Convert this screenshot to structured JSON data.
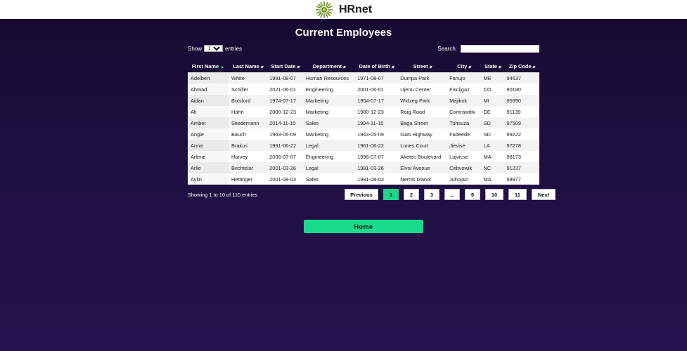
{
  "header": {
    "brand": "HRnet",
    "logo_icon": "green-flower-logo-icon"
  },
  "page": {
    "title": "Current Employees"
  },
  "controls": {
    "show_label": "Show",
    "entries_value": "10",
    "entries_label": "entries",
    "search_label": "Search:",
    "search_value": ""
  },
  "table": {
    "columns": [
      "First Name",
      "Last Name",
      "Start Date",
      "Department",
      "Date of Birth",
      "Street",
      "City",
      "State",
      "Zip Code"
    ],
    "rows": [
      [
        "Adelbert",
        "White",
        "1991-08-07",
        "Human Resources",
        "1971-08-07",
        "Dumpa Park",
        "Fanujo",
        "ME",
        "94637"
      ],
      [
        "Ahmad",
        "Schiller",
        "2021-06-01",
        "Engineering",
        "2001-06-01",
        "Ujenu Center",
        "Fiscijgaz",
        "CO",
        "90180"
      ],
      [
        "Aidan",
        "Botsford",
        "1974-07-17",
        "Marketing",
        "1954-07-17",
        "Widzeg Park",
        "Majikok",
        "MI",
        "95990"
      ],
      [
        "Ali",
        "Hahn",
        "2000-12-23",
        "Marketing",
        "1980-12-23",
        "Roig Road",
        "Comrawdiv",
        "DE",
        "91139"
      ],
      [
        "Amber",
        "Stiedemann",
        "2014-11-10",
        "Sales",
        "1994-11-10",
        "Baga Street",
        "Tuhsuza",
        "SD",
        "97509"
      ],
      [
        "Angie",
        "Bauch",
        "1963-05-09",
        "Marketing",
        "1943-05-09",
        "Gais Highway",
        "Fadeede",
        "SD",
        "99222"
      ],
      [
        "Anna",
        "Brakus",
        "1991-06-22",
        "Legal",
        "1961-06-22",
        "Lunes Court",
        "Jievise",
        "LA",
        "97278"
      ],
      [
        "Arlene",
        "Harvey",
        "2006-07-07",
        "Engineering",
        "1996-07-07",
        "Aketec Boulevard",
        "Lujvicse",
        "MA",
        "98173"
      ],
      [
        "Arlie",
        "Bechtelar",
        "2001-03-26",
        "Legal",
        "1981-03-26",
        "Elvol Avenue",
        "Cebvowik",
        "NC",
        "91237"
      ],
      [
        "Aylin",
        "Hettinger",
        "2001-08-03",
        "Sales",
        "1981-08-03",
        "Nernis Manor",
        "Juhojaci",
        "MA",
        "98977"
      ]
    ]
  },
  "footer": {
    "info": "Showing 1 to 10 of 110 entries",
    "pagination": [
      "Previous",
      "1",
      "2",
      "3",
      "...",
      "9",
      "10",
      "11",
      "Next"
    ],
    "current_page": "1"
  },
  "home_button": "Home",
  "colors": {
    "accent": "#19db8c",
    "background": "#1d0f40"
  }
}
